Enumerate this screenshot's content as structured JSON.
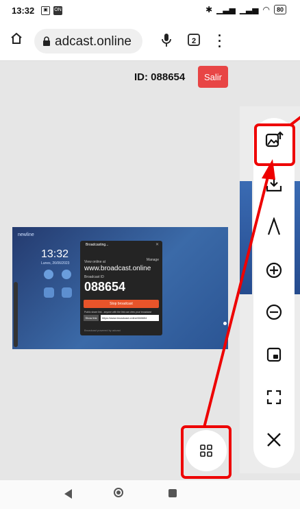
{
  "status_bar": {
    "time": "13:32",
    "battery": "80"
  },
  "browser": {
    "url": "adcast.online",
    "tab_count": "2"
  },
  "page": {
    "id_label": "ID: 088654",
    "exit_label": "Salir"
  },
  "preview": {
    "brand": "newline",
    "time": "13:32",
    "date": "Lunes, 26/06/2023",
    "dialog": {
      "title": "Broadcasting...",
      "view_label": "View online at",
      "manage": "Manage",
      "site": "www.broadcast.online",
      "broadcast_id_label": "Broadcast ID",
      "code": "088654",
      "stop_label": "Stop broadcast",
      "public_text": "Public share link - anyone with the link can view your broadcast",
      "show_label": "Show link",
      "link": "https://www.broadcast.online/088654",
      "footer": "Broadcast powered by adcast"
    }
  },
  "toolbar": {
    "items": [
      "image-upload-icon",
      "download-icon",
      "annotate-icon",
      "zoom-in-icon",
      "zoom-out-icon",
      "pip-icon",
      "fullscreen-icon",
      "close-icon"
    ]
  },
  "fab": {
    "icon": "grid-icon"
  },
  "colors": {
    "accent_red": "#e84545",
    "annotation_red": "#ee0000"
  }
}
